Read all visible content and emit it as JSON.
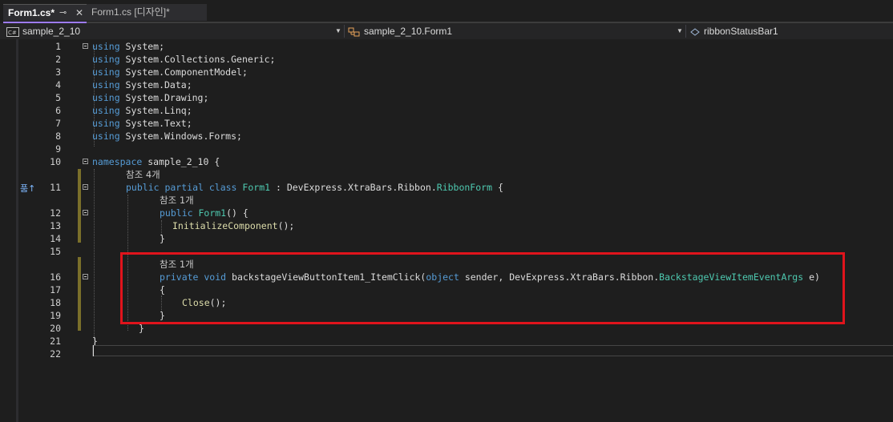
{
  "tabs": [
    {
      "label": "Form1.cs*",
      "pin": "⊸",
      "close": "✕"
    },
    {
      "label": "Form1.cs [디자인]*"
    }
  ],
  "nav": {
    "project": "sample_2_10",
    "class": "sample_2_10.Form1",
    "member": "ribbonStatusBar1",
    "project_icon": "csharp-project-icon",
    "class_icon": "class-icon",
    "member_icon": "field-icon"
  },
  "editor": {
    "lines": [
      {
        "n": "1",
        "tokens": [
          [
            "kw",
            "using"
          ],
          [
            "pl",
            " System;"
          ]
        ]
      },
      {
        "n": "2",
        "tokens": [
          [
            "kw",
            "using"
          ],
          [
            "pl",
            " System.Collections.Generic;"
          ]
        ]
      },
      {
        "n": "3",
        "tokens": [
          [
            "kw",
            "using"
          ],
          [
            "pl",
            " System.ComponentModel;"
          ]
        ]
      },
      {
        "n": "4",
        "tokens": [
          [
            "kw",
            "using"
          ],
          [
            "pl",
            " System.Data;"
          ]
        ]
      },
      {
        "n": "5",
        "tokens": [
          [
            "kw",
            "using"
          ],
          [
            "pl",
            " System.Drawing;"
          ]
        ]
      },
      {
        "n": "6",
        "tokens": [
          [
            "kw",
            "using"
          ],
          [
            "pl",
            " System.Linq;"
          ]
        ]
      },
      {
        "n": "7",
        "tokens": [
          [
            "kw",
            "using"
          ],
          [
            "pl",
            " System.Text;"
          ]
        ]
      },
      {
        "n": "8",
        "tokens": [
          [
            "kw",
            "using"
          ],
          [
            "pl",
            " System.Windows.Forms;"
          ]
        ]
      },
      {
        "n": "9",
        "tokens": []
      },
      {
        "n": "10",
        "tokens": [
          [
            "kw",
            "namespace"
          ],
          [
            "pl",
            " sample_2_10 {"
          ]
        ]
      },
      {
        "n": "",
        "ref": "참조 4개"
      },
      {
        "n": "11",
        "tokens": [
          [
            "kw",
            "public partial class"
          ],
          [
            "pl",
            " "
          ],
          [
            "ty",
            "Form1"
          ],
          [
            "pl",
            " : DevExpress.XtraBars.Ribbon."
          ],
          [
            "ty",
            "RibbonForm"
          ],
          [
            "pl",
            " {"
          ]
        ]
      },
      {
        "n": "",
        "ref": "참조 1개"
      },
      {
        "n": "12",
        "tokens": [
          [
            "kw",
            "public"
          ],
          [
            "pl",
            " "
          ],
          [
            "ty",
            "Form1"
          ],
          [
            "pl",
            "() {"
          ]
        ]
      },
      {
        "n": "13",
        "tokens": [
          [
            "mth",
            "InitializeComponent"
          ],
          [
            "pl",
            "();"
          ]
        ]
      },
      {
        "n": "14",
        "tokens": [
          [
            "pl",
            "}"
          ]
        ]
      },
      {
        "n": "15",
        "tokens": []
      },
      {
        "n": "",
        "ref": "참조 1개"
      },
      {
        "n": "16",
        "tokens": [
          [
            "kw",
            "private void"
          ],
          [
            "pl",
            " backstageViewButtonItem1_ItemClick("
          ],
          [
            "kw",
            "object"
          ],
          [
            "pl",
            " sender, DevExpress.XtraBars.Ribbon."
          ],
          [
            "ty",
            "BackstageViewItemEventArgs"
          ],
          [
            "pl",
            " e)"
          ]
        ]
      },
      {
        "n": "17",
        "tokens": [
          [
            "pl",
            "{"
          ]
        ]
      },
      {
        "n": "18",
        "tokens": [
          [
            "mth",
            "Close"
          ],
          [
            "pl",
            "();"
          ]
        ]
      },
      {
        "n": "19",
        "tokens": [
          [
            "pl",
            "}"
          ]
        ]
      },
      {
        "n": "20",
        "tokens": [
          [
            "pl",
            "}"
          ]
        ]
      },
      {
        "n": "21",
        "tokens": [
          [
            "pl",
            "}"
          ]
        ]
      },
      {
        "n": "22",
        "tokens": []
      }
    ]
  },
  "glyph": "품↑",
  "colors": {
    "highlight": "#e0141c",
    "keyword": "#569cd6",
    "type": "#4ec9b0",
    "method": "#dcdcaa"
  }
}
